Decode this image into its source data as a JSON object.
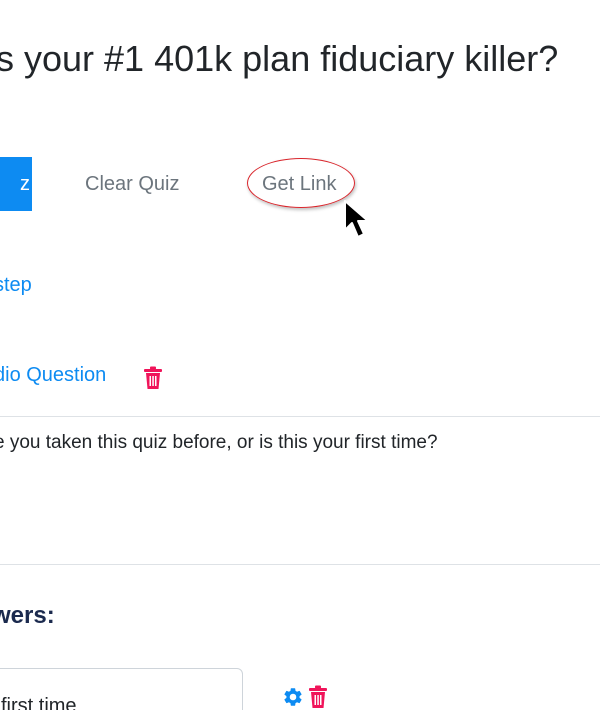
{
  "title": "s your #1 401k plan fiduciary killer?",
  "toolbar": {
    "primary_label": "z",
    "clear_label": "Clear Quiz",
    "get_link_label": "Get Link"
  },
  "step_link": "step",
  "question": {
    "type_label": "dio Question",
    "text": "e you taken this quiz before, or is this your first time?"
  },
  "answers": {
    "heading": "wers:",
    "items": [
      {
        "value": "first time"
      }
    ]
  },
  "colors": {
    "primary": "#0d8bf2",
    "danger": "#f0145a",
    "annotation_circle": "#d9262c"
  }
}
